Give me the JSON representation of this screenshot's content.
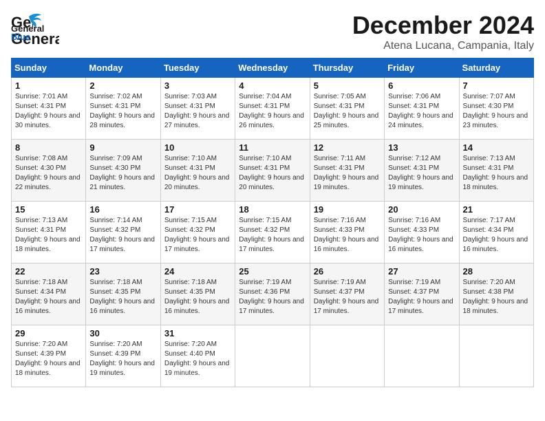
{
  "logo": {
    "line1": "General",
    "line2": "Blue"
  },
  "title": "December 2024",
  "location": "Atena Lucana, Campania, Italy",
  "days_header": [
    "Sunday",
    "Monday",
    "Tuesday",
    "Wednesday",
    "Thursday",
    "Friday",
    "Saturday"
  ],
  "weeks": [
    [
      {
        "day": "1",
        "sunrise": "7:01 AM",
        "sunset": "4:31 PM",
        "daylight": "9 hours and 30 minutes."
      },
      {
        "day": "2",
        "sunrise": "7:02 AM",
        "sunset": "4:31 PM",
        "daylight": "9 hours and 28 minutes."
      },
      {
        "day": "3",
        "sunrise": "7:03 AM",
        "sunset": "4:31 PM",
        "daylight": "9 hours and 27 minutes."
      },
      {
        "day": "4",
        "sunrise": "7:04 AM",
        "sunset": "4:31 PM",
        "daylight": "9 hours and 26 minutes."
      },
      {
        "day": "5",
        "sunrise": "7:05 AM",
        "sunset": "4:31 PM",
        "daylight": "9 hours and 25 minutes."
      },
      {
        "day": "6",
        "sunrise": "7:06 AM",
        "sunset": "4:31 PM",
        "daylight": "9 hours and 24 minutes."
      },
      {
        "day": "7",
        "sunrise": "7:07 AM",
        "sunset": "4:30 PM",
        "daylight": "9 hours and 23 minutes."
      }
    ],
    [
      {
        "day": "8",
        "sunrise": "7:08 AM",
        "sunset": "4:30 PM",
        "daylight": "9 hours and 22 minutes."
      },
      {
        "day": "9",
        "sunrise": "7:09 AM",
        "sunset": "4:30 PM",
        "daylight": "9 hours and 21 minutes."
      },
      {
        "day": "10",
        "sunrise": "7:10 AM",
        "sunset": "4:31 PM",
        "daylight": "9 hours and 20 minutes."
      },
      {
        "day": "11",
        "sunrise": "7:10 AM",
        "sunset": "4:31 PM",
        "daylight": "9 hours and 20 minutes."
      },
      {
        "day": "12",
        "sunrise": "7:11 AM",
        "sunset": "4:31 PM",
        "daylight": "9 hours and 19 minutes."
      },
      {
        "day": "13",
        "sunrise": "7:12 AM",
        "sunset": "4:31 PM",
        "daylight": "9 hours and 19 minutes."
      },
      {
        "day": "14",
        "sunrise": "7:13 AM",
        "sunset": "4:31 PM",
        "daylight": "9 hours and 18 minutes."
      }
    ],
    [
      {
        "day": "15",
        "sunrise": "7:13 AM",
        "sunset": "4:31 PM",
        "daylight": "9 hours and 18 minutes."
      },
      {
        "day": "16",
        "sunrise": "7:14 AM",
        "sunset": "4:32 PM",
        "daylight": "9 hours and 17 minutes."
      },
      {
        "day": "17",
        "sunrise": "7:15 AM",
        "sunset": "4:32 PM",
        "daylight": "9 hours and 17 minutes."
      },
      {
        "day": "18",
        "sunrise": "7:15 AM",
        "sunset": "4:32 PM",
        "daylight": "9 hours and 17 minutes."
      },
      {
        "day": "19",
        "sunrise": "7:16 AM",
        "sunset": "4:33 PM",
        "daylight": "9 hours and 16 minutes."
      },
      {
        "day": "20",
        "sunrise": "7:16 AM",
        "sunset": "4:33 PM",
        "daylight": "9 hours and 16 minutes."
      },
      {
        "day": "21",
        "sunrise": "7:17 AM",
        "sunset": "4:34 PM",
        "daylight": "9 hours and 16 minutes."
      }
    ],
    [
      {
        "day": "22",
        "sunrise": "7:18 AM",
        "sunset": "4:34 PM",
        "daylight": "9 hours and 16 minutes."
      },
      {
        "day": "23",
        "sunrise": "7:18 AM",
        "sunset": "4:35 PM",
        "daylight": "9 hours and 16 minutes."
      },
      {
        "day": "24",
        "sunrise": "7:18 AM",
        "sunset": "4:35 PM",
        "daylight": "9 hours and 16 minutes."
      },
      {
        "day": "25",
        "sunrise": "7:19 AM",
        "sunset": "4:36 PM",
        "daylight": "9 hours and 17 minutes."
      },
      {
        "day": "26",
        "sunrise": "7:19 AM",
        "sunset": "4:37 PM",
        "daylight": "9 hours and 17 minutes."
      },
      {
        "day": "27",
        "sunrise": "7:19 AM",
        "sunset": "4:37 PM",
        "daylight": "9 hours and 17 minutes."
      },
      {
        "day": "28",
        "sunrise": "7:20 AM",
        "sunset": "4:38 PM",
        "daylight": "9 hours and 18 minutes."
      }
    ],
    [
      {
        "day": "29",
        "sunrise": "7:20 AM",
        "sunset": "4:39 PM",
        "daylight": "9 hours and 18 minutes."
      },
      {
        "day": "30",
        "sunrise": "7:20 AM",
        "sunset": "4:39 PM",
        "daylight": "9 hours and 19 minutes."
      },
      {
        "day": "31",
        "sunrise": "7:20 AM",
        "sunset": "4:40 PM",
        "daylight": "9 hours and 19 minutes."
      },
      null,
      null,
      null,
      null
    ]
  ]
}
